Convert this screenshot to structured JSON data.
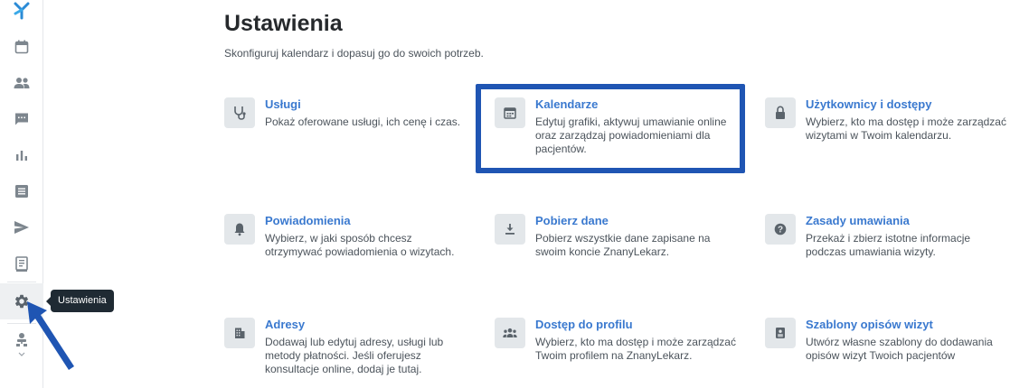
{
  "sidebar": {
    "items": [
      {
        "name": "logo-icon"
      },
      {
        "name": "calendar-icon"
      },
      {
        "name": "patients-icon"
      },
      {
        "name": "messages-icon"
      },
      {
        "name": "stats-icon"
      },
      {
        "name": "list-icon"
      },
      {
        "name": "send-icon"
      },
      {
        "name": "book-icon"
      },
      {
        "name": "gear-icon",
        "active": true
      },
      {
        "name": "user-org-icon"
      }
    ],
    "tooltip": "Ustawienia"
  },
  "main": {
    "title": "Ustawienia",
    "subtitle": "Skonfiguruj kalendarz i dopasuj go do swoich potrzeb."
  },
  "cards": [
    {
      "title": "Usługi",
      "desc": "Pokaż oferowane usługi, ich cenę i czas.",
      "icon": "stethoscope-icon"
    },
    {
      "title": "Kalendarze",
      "desc": "Edytuj grafiki, aktywuj umawianie online oraz zarządzaj powiadomieniami dla pacjentów.",
      "icon": "calendar-icon"
    },
    {
      "title": "Użytkownicy i dostępy",
      "desc": "Wybierz, kto ma dostęp i może zarządzać wizytami w Twoim kalendarzu.",
      "icon": "lock-icon"
    },
    {
      "title": "Powiadomienia",
      "desc": "Wybierz, w jaki sposób chcesz otrzymywać powiadomienia o wizytach.",
      "icon": "bell-icon"
    },
    {
      "title": "Pobierz dane",
      "desc": "Pobierz wszystkie dane zapisane na swoim koncie ZnanyLekarz.",
      "icon": "download-icon"
    },
    {
      "title": "Zasady umawiania",
      "desc": "Przekaż i zbierz istotne informacje podczas umawiania wizyty.",
      "icon": "question-icon"
    },
    {
      "title": "Adresy",
      "desc": "Dodawaj lub edytuj adresy, usługi lub metody płatności. Jeśli oferujesz konsultacje online, dodaj je tutaj.",
      "icon": "building-icon"
    },
    {
      "title": "Dostęp do profilu",
      "desc": "Wybierz, kto ma dostęp i może zarządzać Twoim profilem na ZnanyLekarz.",
      "icon": "group-icon"
    },
    {
      "title": "Szablony opisów wizyt",
      "desc": "Utwórz własne szablony do dodawania opisów wizyt Twoich pacjentów",
      "icon": "template-icon"
    }
  ],
  "colors": {
    "accent": "#3a79cf",
    "highlight": "#1f55b3",
    "icon_bg": "#e3e7ea"
  }
}
